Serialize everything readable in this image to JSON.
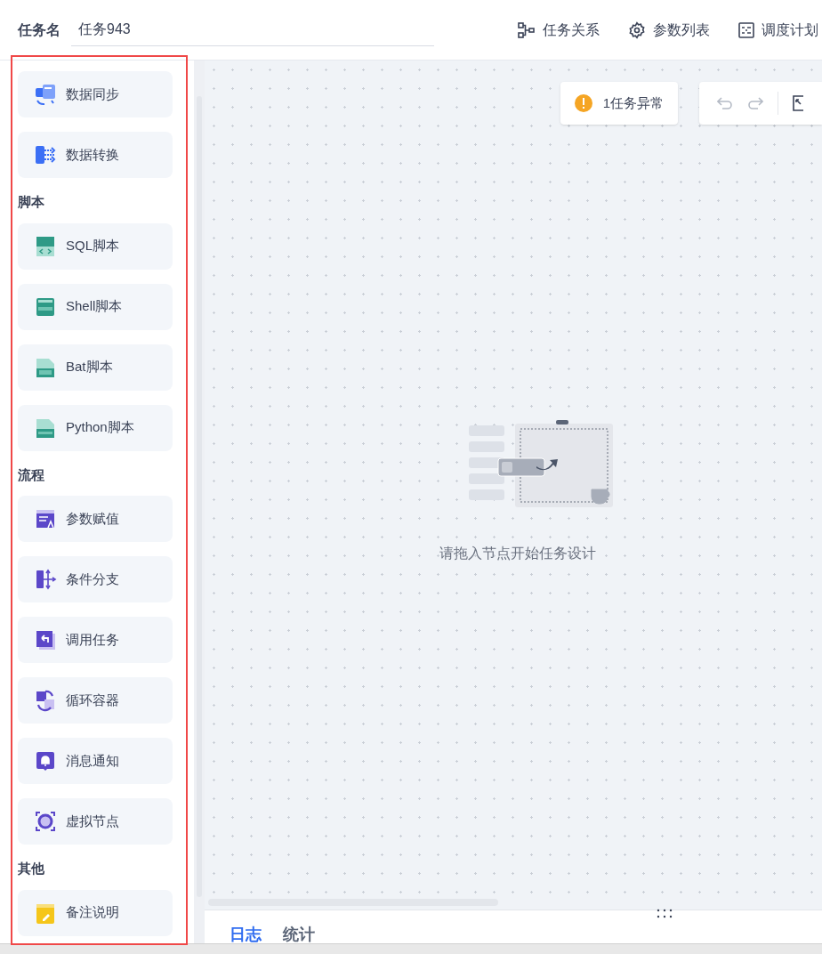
{
  "header": {
    "label": "任务名",
    "task_name": "任务943",
    "actions": [
      {
        "label": "任务关系",
        "kind": "relation"
      },
      {
        "label": "参数列表",
        "kind": "params"
      },
      {
        "label": "调度计划",
        "kind": "schedule"
      }
    ]
  },
  "sidebar": {
    "sections": [
      {
        "items": [
          {
            "label": "数据同步",
            "kind": "sync"
          },
          {
            "label": "数据转换",
            "kind": "transform"
          }
        ]
      },
      {
        "title": "脚本",
        "items": [
          {
            "label": "SQL脚本",
            "kind": "sql"
          },
          {
            "label": "Shell脚本",
            "kind": "shell"
          },
          {
            "label": "Bat脚本",
            "kind": "bat"
          },
          {
            "label": "Python脚本",
            "kind": "python"
          }
        ]
      },
      {
        "title": "流程",
        "items": [
          {
            "label": "参数赋值",
            "kind": "param"
          },
          {
            "label": "条件分支",
            "kind": "branch"
          },
          {
            "label": "调用任务",
            "kind": "call"
          },
          {
            "label": "循环容器",
            "kind": "loop"
          },
          {
            "label": "消息通知",
            "kind": "notify"
          },
          {
            "label": "虚拟节点",
            "kind": "virtual"
          }
        ]
      },
      {
        "title": "其他",
        "items": [
          {
            "label": "备注说明",
            "kind": "note"
          }
        ]
      }
    ]
  },
  "canvas": {
    "alert": "1任务异常",
    "empty_hint": "请拖入节点开始任务设计"
  },
  "bottom_tabs": [
    {
      "label": "日志",
      "selected": true
    },
    {
      "label": "统计",
      "selected": false
    }
  ]
}
